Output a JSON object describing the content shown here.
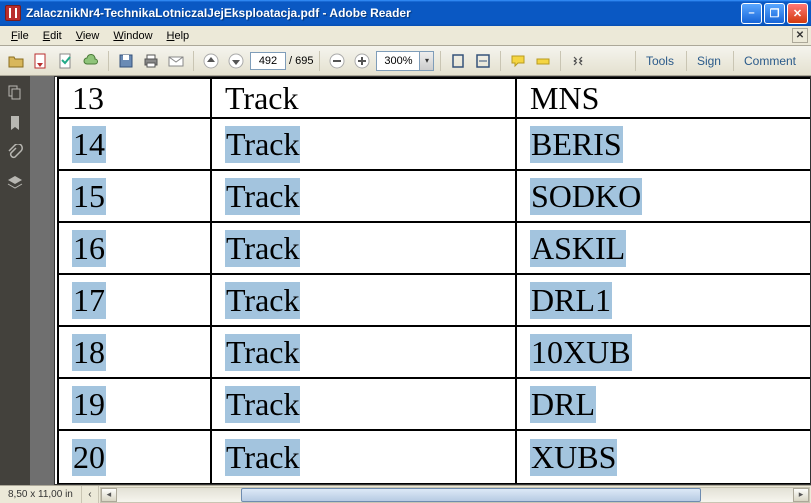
{
  "title": "ZalacznikNr4-TechnikaLotniczaIJejEksploatacja.pdf - Adobe Reader",
  "menu": {
    "file": "File",
    "edit": "Edit",
    "view": "View",
    "window": "Window",
    "help": "Help"
  },
  "toolbar": {
    "page_current": "492",
    "page_total": "/ 695",
    "zoom": "300%",
    "tools": "Tools",
    "sign": "Sign",
    "comment": "Comment"
  },
  "table": {
    "rows": [
      {
        "n": "13",
        "type": "Track",
        "code": "MNS",
        "selected": false
      },
      {
        "n": "14",
        "type": "Track",
        "code": "BERIS",
        "selected": true
      },
      {
        "n": "15",
        "type": "Track",
        "code": "SODKO",
        "selected": true
      },
      {
        "n": "16",
        "type": "Track",
        "code": "ASKIL",
        "selected": true
      },
      {
        "n": "17",
        "type": "Track",
        "code": "DRL1",
        "selected": true
      },
      {
        "n": "18",
        "type": "Track",
        "code": "10XUB",
        "selected": true
      },
      {
        "n": "19",
        "type": "Track",
        "code": "DRL",
        "selected": true
      },
      {
        "n": "20",
        "type": "Track",
        "code": "XUBS",
        "selected": true
      }
    ]
  },
  "status": {
    "pagesize": "8,50 x 11,00 in"
  }
}
